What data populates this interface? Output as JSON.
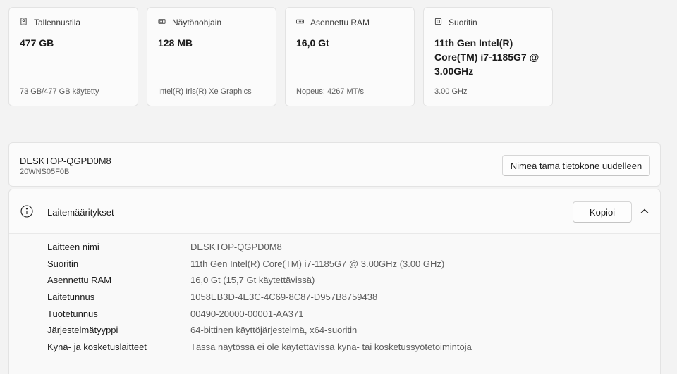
{
  "cards": [
    {
      "icon": "storage-icon",
      "label": "Tallennustila",
      "value": "477 GB",
      "sub": "73 GB/477 GB käytetty"
    },
    {
      "icon": "gpu-icon",
      "label": "Näytönohjain",
      "value": "128 MB",
      "sub": "Intel(R) Iris(R) Xe Graphics"
    },
    {
      "icon": "ram-icon",
      "label": "Asennettu RAM",
      "value": "16,0 Gt",
      "sub": "Nopeus: 4267 MT/s"
    },
    {
      "icon": "cpu-icon",
      "label": "Suoritin",
      "value": "11th Gen Intel(R) Core(TM) i7-1185G7 @ 3.00GHz",
      "sub": "3.00 GHz"
    }
  ],
  "device": {
    "name": "DESKTOP-QGPD0M8",
    "model": "20WNS05F0B",
    "rename_label": "Nimeä tämä tietokone uudelleen"
  },
  "specs": {
    "title": "Laitemääritykset",
    "copy_label": "Kopioi",
    "rows": [
      {
        "key": "Laitteen nimi",
        "value": "DESKTOP-QGPD0M8"
      },
      {
        "key": "Suoritin",
        "value": "11th Gen Intel(R) Core(TM) i7-1185G7 @ 3.00GHz (3.00 GHz)"
      },
      {
        "key": "Asennettu RAM",
        "value": "16,0 Gt (15,7 Gt käytettävissä)"
      },
      {
        "key": "Laitetunnus",
        "value": "1058EB3D-4E3C-4C69-8C87-D957B8759438"
      },
      {
        "key": "Tuotetunnus",
        "value": "00490-20000-00001-AA371"
      },
      {
        "key": "Järjestelmätyyppi",
        "value": "64-bittinen käyttöjärjestelmä, x64-suoritin"
      },
      {
        "key": "Kynä- ja kosketuslaitteet",
        "value": "Tässä näytössä ei ole käytettävissä kynä- tai kosketussyötetoimintoja"
      }
    ]
  }
}
